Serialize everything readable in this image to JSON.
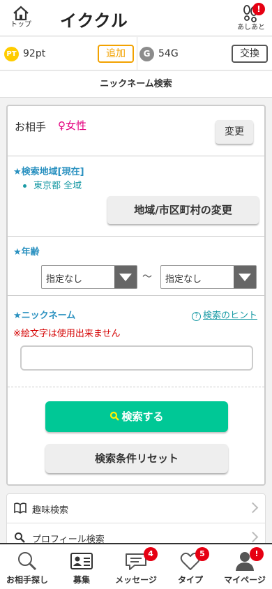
{
  "header": {
    "home_label": "トップ",
    "app_title": "イククル",
    "footprints_label": "あしあと",
    "footprints_alert": "!"
  },
  "points": {
    "pt_badge": "PT",
    "pt_value": "92pt",
    "add_label": "追加",
    "g_badge": "G",
    "g_value": "54G",
    "exchange_label": "交換"
  },
  "page_title": "ニックネーム検索",
  "search": {
    "partner_label": "お相手",
    "partner_value": "♀女性",
    "change_label": "変更",
    "area_label": "★検索地域[現在]",
    "area_value": "東京都 全域",
    "area_change_label": "地域/市区町村の変更",
    "age_label": "★年齢",
    "age_min": "指定なし",
    "age_max": "指定なし",
    "age_separator": "〜",
    "nickname_label": "★ニックネーム",
    "hint_label": "検索のヒント",
    "warning": "※絵文字は使用出来ません",
    "nickname_value": "",
    "search_button": "検索する",
    "reset_button": "検索条件リセット"
  },
  "menu": {
    "items": [
      {
        "label": "趣味検索",
        "icon": "book-icon"
      },
      {
        "label": "プロフィール検索",
        "icon": "search-icon"
      }
    ]
  },
  "tabbar": {
    "items": [
      {
        "label": "お相手探し",
        "icon": "search-icon",
        "count": ""
      },
      {
        "label": "募集",
        "icon": "id-card-icon",
        "count": ""
      },
      {
        "label": "メッセージ",
        "icon": "chat-bubble-icon",
        "count": "4"
      },
      {
        "label": "タイプ",
        "icon": "heart-icon",
        "count": "5"
      },
      {
        "label": "マイページ",
        "icon": "person-icon",
        "count": "!"
      }
    ]
  },
  "colors": {
    "accent_green": "#00c896",
    "alert_red": "#e60012",
    "link_teal": "#1a9aa5",
    "female_pink": "#e4007f",
    "add_orange": "#f2a200"
  }
}
